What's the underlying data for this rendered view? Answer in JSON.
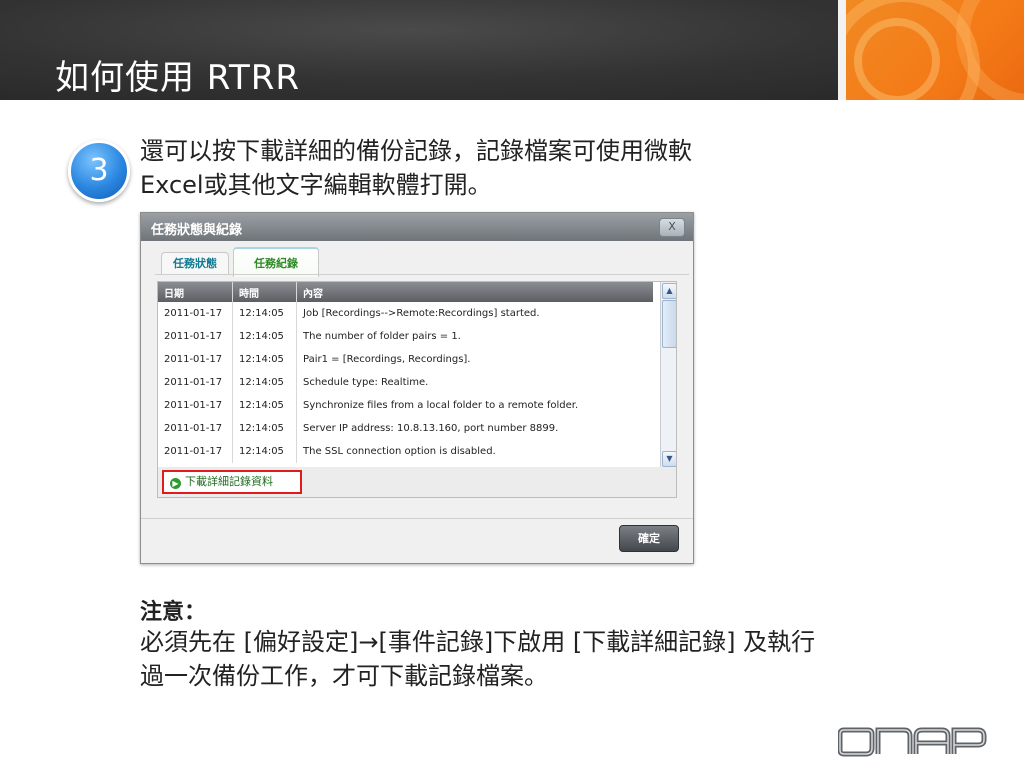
{
  "slide": {
    "title": "如何使用 RTRR",
    "step_number": "3",
    "step_text_line1": "還可以按下載詳細的備份記錄，記錄檔案可使用微軟",
    "step_text_line2": "Excel或其他文字編輯軟體打開。"
  },
  "dialog": {
    "title": "任務狀態與紀錄",
    "close_label": "X",
    "tabs": [
      {
        "label": "任務狀態",
        "active": false
      },
      {
        "label": "任務紀錄",
        "active": true
      }
    ],
    "columns": [
      "日期",
      "時間",
      "內容"
    ],
    "rows": [
      {
        "date": "2011-01-17",
        "time": "12:14:05",
        "content": "Job [Recordings-->Remote:Recordings] started."
      },
      {
        "date": "2011-01-17",
        "time": "12:14:05",
        "content": "The number of folder pairs = 1."
      },
      {
        "date": "2011-01-17",
        "time": "12:14:05",
        "content": "Pair1 = [Recordings, Recordings]."
      },
      {
        "date": "2011-01-17",
        "time": "12:14:05",
        "content": "Schedule type: Realtime."
      },
      {
        "date": "2011-01-17",
        "time": "12:14:05",
        "content": "Synchronize files from a local folder to a remote folder."
      },
      {
        "date": "2011-01-17",
        "time": "12:14:05",
        "content": "Server IP address: 10.8.13.160, port number 8899."
      },
      {
        "date": "2011-01-17",
        "time": "12:14:05",
        "content": "The SSL connection option is disabled."
      }
    ],
    "download_link": "下載詳細記錄資料",
    "ok_label": "確定"
  },
  "note": {
    "title": "注意：",
    "line1": "必須先在 [偏好設定]→[事件記錄]下啟用 [下載詳細記錄] 及執行",
    "line2": "過一次備份工作，才可下載記錄檔案。"
  },
  "logo_text": "QNAP",
  "colors": {
    "header_bg": "#333333",
    "accent_orange": "#f47a17",
    "badge_blue": "#2a86e0",
    "highlight_red": "#e01b1b"
  }
}
